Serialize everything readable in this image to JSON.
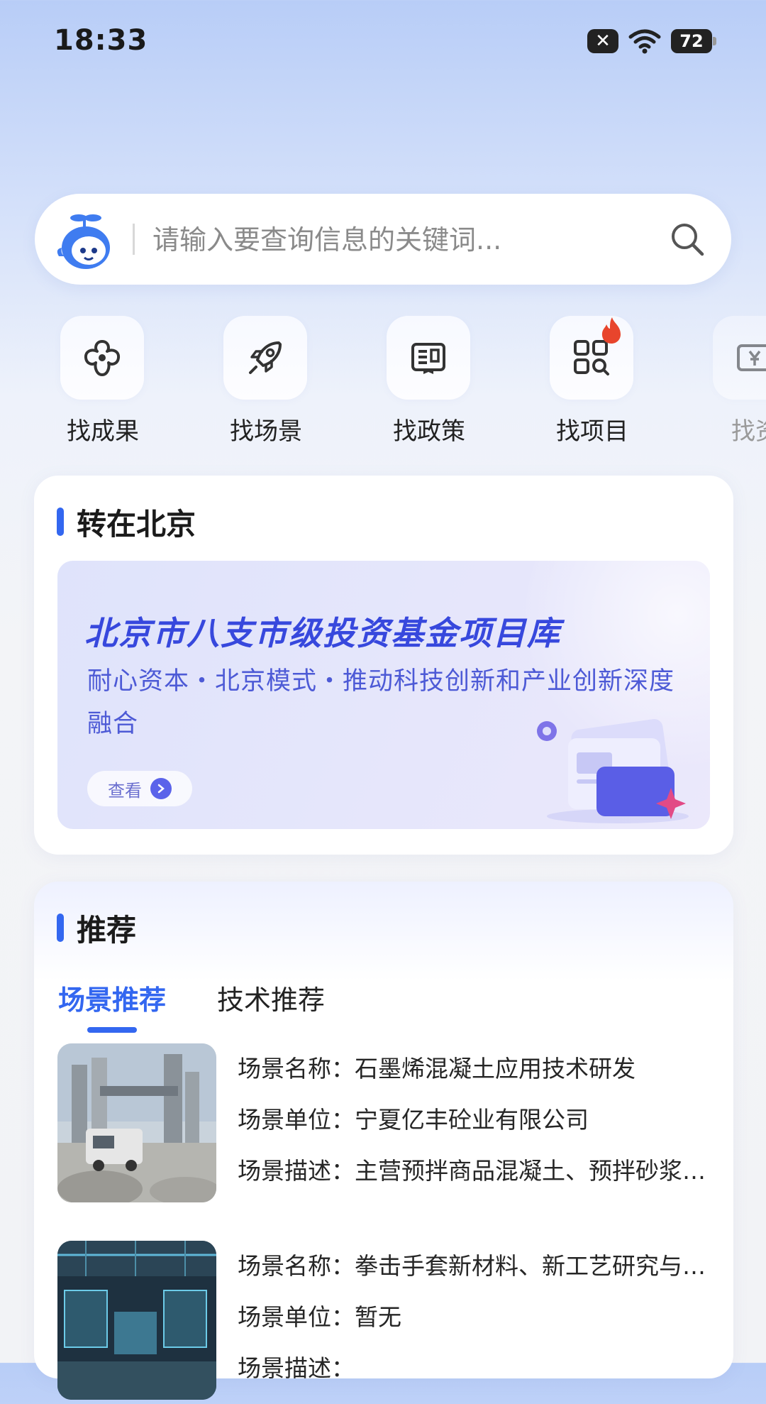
{
  "status_bar": {
    "time": "18:33",
    "battery": "72"
  },
  "search": {
    "placeholder": "请输入要查询信息的关键词..."
  },
  "quick_nav": [
    {
      "label": "找成果",
      "icon": "cloud-flower-icon"
    },
    {
      "label": "找场景",
      "icon": "rocket-icon"
    },
    {
      "label": "找政策",
      "icon": "policy-book-icon"
    },
    {
      "label": "找项目",
      "icon": "grid-search-icon",
      "hot": true
    },
    {
      "label": "找资",
      "icon": "yen-card-icon"
    }
  ],
  "beijing": {
    "title": "转在北京",
    "banner_title": "北京市八支市级投资基金项目库",
    "banner_subtitle": "耐心资本・北京模式・推动科技创新和产业创新深度融合",
    "banner_button": "查看"
  },
  "recommend": {
    "title": "推荐",
    "tabs": [
      "场景推荐",
      "技术推荐"
    ],
    "active_tab": 0,
    "items": [
      {
        "name_label": "场景名称：",
        "name": "石墨烯混凝土应用技术研发",
        "unit_label": "场景单位：",
        "unit": "宁夏亿丰砼业有限公司",
        "desc_label": "场景描述：",
        "desc": "主营预拌商品混凝土、预拌砂浆的生产与销售"
      },
      {
        "name_label": "场景名称：",
        "name": "拳击手套新材料、新工艺研究与开发",
        "unit_label": "场景单位：",
        "unit": "暂无",
        "desc_label": "场景描述：",
        "desc": ""
      }
    ]
  },
  "colors": {
    "accent": "#3367f0",
    "banner_text": "#3748dd"
  }
}
